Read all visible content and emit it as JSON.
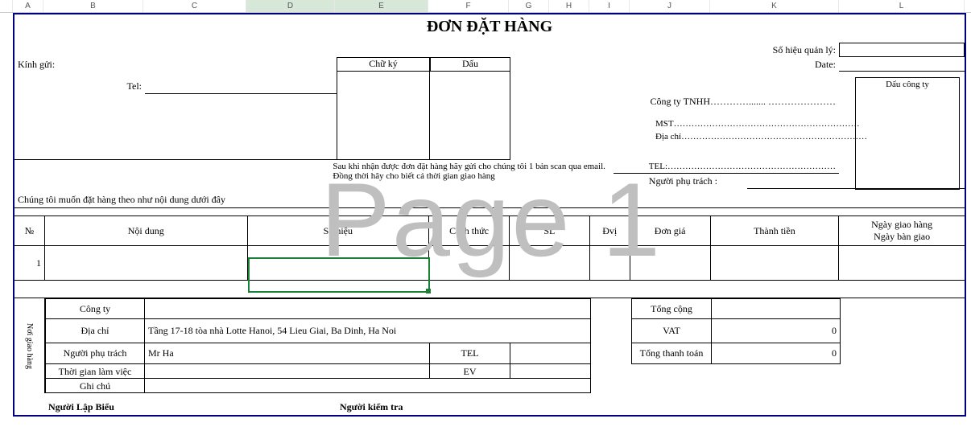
{
  "columns": {
    "A": "A",
    "B": "B",
    "C": "C",
    "D": "D",
    "E": "E",
    "F": "F",
    "G": "G",
    "H": "H",
    "I": "I",
    "J": "J",
    "K": "K",
    "L": "L"
  },
  "title": "ĐƠN ĐẶT HÀNG",
  "header": {
    "so_hieu_ql_label": "Số hiệu quản lý:",
    "kinh_gui_label": "Kính gửi:",
    "chu_ky": "Chữ ký",
    "dau": "Dấu",
    "date_label": "Date:",
    "tel_label": "Tel:",
    "dau_cong_ty": "Dấu công ty",
    "cong_ty_tnhh": "Công ty TNHH…………....... …………………",
    "mst": "MST………………………………………………………",
    "dia_chi": "Địa chỉ………………………………………………………",
    "tel2": "TEL:…………………………………………………",
    "nguoi_phu_trach_right": "Người phụ trách :",
    "note": "Sau khi nhận được đơn đặt hàng hãy gửi cho chúng tôi 1 bản scan qua email. Đồng thời hãy cho biết cả thời gian giao hàng",
    "intro": "Chúng tôi muốn đặt hàng theo như nội dung dưới đây"
  },
  "table": {
    "headers": {
      "no": "№",
      "noi_dung": "Nội dung",
      "so_hieu": "Số hiệu",
      "cach_thuc": "Cách thức",
      "sl": "SL",
      "dvi": "Đvị",
      "don_gia": "Đơn giá",
      "thanh_tien": "Thành tiền",
      "ngay": "Ngày giao hàng",
      "ngay2": "Ngày bàn giao"
    },
    "rows": [
      {
        "no": "1"
      }
    ]
  },
  "footer": {
    "cong_ty": "Công ty",
    "dia_chi": "Địa chỉ",
    "dia_chi_val": "Tầng 17-18 tòa nhà Lotte Hanoi, 54 Lieu Giai, Ba Dinh, Ha Noi",
    "nguoi_phu_trach": "Người phụ trách",
    "nguoi_phu_trach_val": "Mr Ha",
    "tel": "TEL",
    "thoi_gian": "Thời gian làm việc",
    "ev": "EV",
    "ghi_chu": "Ghi chú",
    "noi_giao_hang": "Nơi giao hàng",
    "tong_cong": "Tổng cộng",
    "vat": "VAT",
    "vat_val": "0",
    "tong_tt": "Tổng thanh toán",
    "tong_tt_val": "0",
    "lap_bieu": "Người Lập Biểu",
    "kiem_tra": "Người kiểm tra"
  },
  "watermark": "Page 1"
}
